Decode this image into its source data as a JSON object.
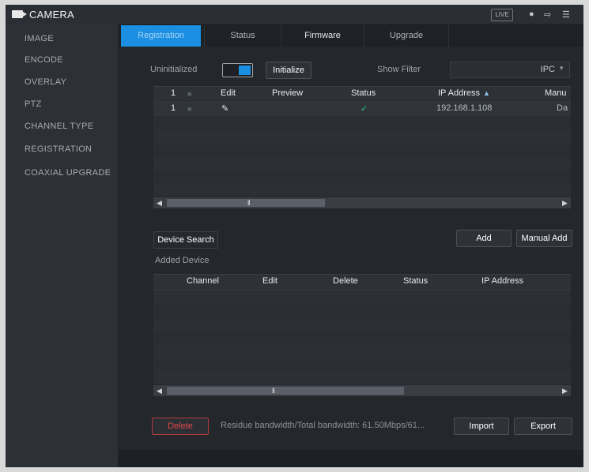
{
  "titlebar": {
    "title": "CAMERA",
    "live": "LIVE",
    "icons": [
      "user-icon",
      "logout-icon",
      "menu-icon"
    ]
  },
  "sidebar": {
    "items": [
      {
        "label": "IMAGE"
      },
      {
        "label": "ENCODE"
      },
      {
        "label": "OVERLAY"
      },
      {
        "label": "PTZ"
      },
      {
        "label": "CHANNEL TYPE"
      },
      {
        "label": "REGISTRATION"
      },
      {
        "label": "COAXIAL UPGRADE"
      }
    ]
  },
  "tabs": [
    {
      "label": "Registration",
      "active": true
    },
    {
      "label": "Status"
    },
    {
      "label": "Firmware"
    },
    {
      "label": "Upgrade"
    }
  ],
  "toolbar": {
    "uninitialized_label": "Uninitialized",
    "initialize_button": "Initialize",
    "show_filter_label": "Show Filter",
    "filter_value": "IPC"
  },
  "search_table": {
    "columns": [
      "",
      "Edit",
      "Preview",
      "Status",
      "IP Address",
      "Manu"
    ],
    "rows": [
      [
        "1",
        "",
        "",
        "",
        "",
        ""
      ],
      [
        "1",
        "edit-icon",
        "",
        "check-icon",
        "192.168.1.108",
        "Da"
      ]
    ]
  },
  "middle": {
    "device_search": "Device Search",
    "add": "Add",
    "manual_add": "Manual Add",
    "added_device": "Added Device"
  },
  "added_table": {
    "columns": [
      "Channel",
      "Edit",
      "Delete",
      "Status",
      "IP Address"
    ]
  },
  "bottom": {
    "delete": "Delete",
    "bandwidth": "Residue bandwidth/Total bandwidth:  61.50Mbps/61...",
    "import": "Import",
    "export": "Export"
  },
  "colors": {
    "accent": "#1b8fe2",
    "danger": "#e24848",
    "ok": "#2fbf7a"
  }
}
